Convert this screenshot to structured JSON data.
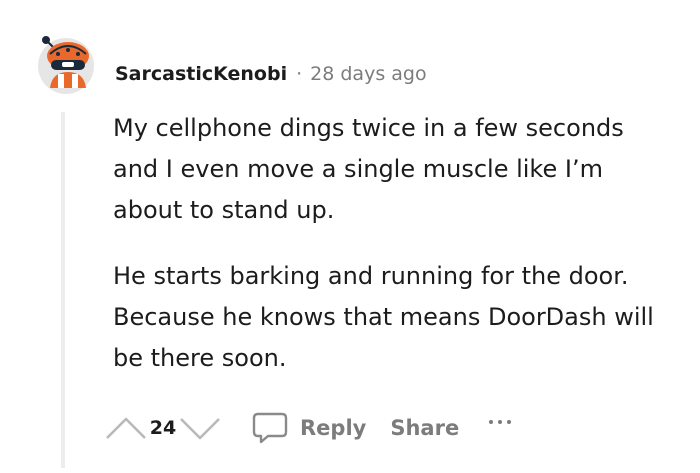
{
  "comment": {
    "author": "SarcasticKenobi",
    "separator": "·",
    "timestamp": "28 days ago",
    "paragraphs": [
      "My cellphone dings twice in a few seconds and I even move a single muscle like I’m about to stand up.",
      "He starts barking and running for the door. Because he knows that means DoorDash will be there soon."
    ],
    "score": "24",
    "reply_label": "Reply",
    "share_label": "Share",
    "more_label": "···",
    "icons": {
      "avatar": "snoo-avatar-icon",
      "upvote": "upvote-arrow-icon",
      "downvote": "downvote-arrow-icon",
      "reply": "speech-bubble-icon",
      "more": "more-dots-icon"
    },
    "colors": {
      "text": "#1c1c1c",
      "meta": "#7c7c7c",
      "avatar_orange": "#e8692b",
      "thread_line": "#ededed"
    }
  }
}
